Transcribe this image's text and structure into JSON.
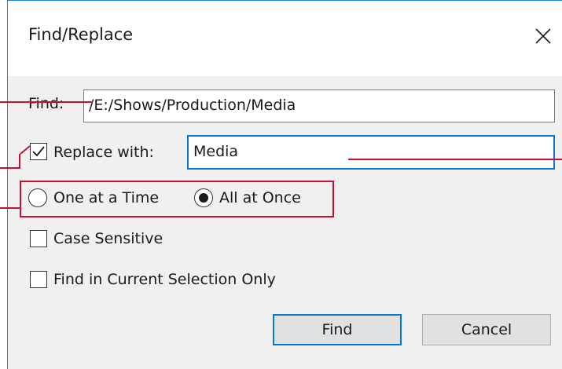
{
  "dialog": {
    "title": "Find/Replace",
    "close_icon": "close-icon"
  },
  "find": {
    "label": "Find:",
    "value": "/E:/Shows/Production/Media"
  },
  "replace": {
    "checked": true,
    "label": "Replace with:",
    "value": "Media"
  },
  "mode": {
    "options": [
      {
        "label": "One at a Time",
        "selected": false
      },
      {
        "label": "All at Once",
        "selected": true
      }
    ]
  },
  "case_sensitive": {
    "label": "Case Sensitive",
    "checked": false
  },
  "current_selection": {
    "label": "Find in Current Selection Only",
    "checked": false
  },
  "buttons": {
    "find_label": "Find",
    "cancel_label": "Cancel"
  },
  "colors": {
    "accent": "#0078d7",
    "annotation": "#c8102e",
    "dialog_bg": "#f0f0f0"
  }
}
